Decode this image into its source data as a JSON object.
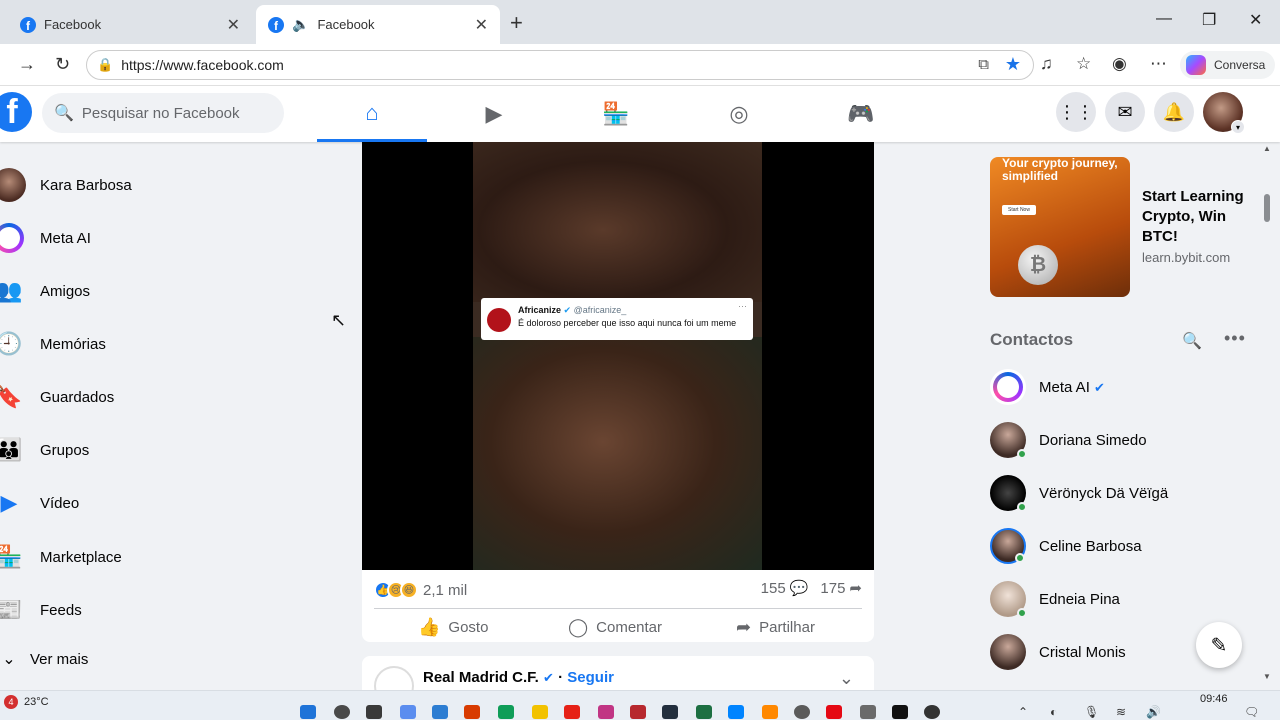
{
  "browser": {
    "tabs": [
      {
        "title": "Facebook",
        "active": false
      },
      {
        "title": "Facebook",
        "active": true
      }
    ],
    "url": "https://www.facebook.com",
    "conversa_label": "Conversa"
  },
  "header": {
    "logo": "f",
    "search_placeholder": "Pesquisar no Facebook",
    "nav_icons": [
      "home-icon",
      "video-icon",
      "marketplace-icon",
      "groups-icon",
      "gaming-icon"
    ]
  },
  "sidebar": {
    "items": [
      {
        "label": "Kara Barbosa",
        "icon": "profile-avatar"
      },
      {
        "label": "Meta AI",
        "icon": "meta-ai-icon"
      },
      {
        "label": "Amigos",
        "icon": "friends-icon"
      },
      {
        "label": "Memórias",
        "icon": "memories-icon"
      },
      {
        "label": "Guardados",
        "icon": "saved-icon"
      },
      {
        "label": "Grupos",
        "icon": "groups-icon"
      },
      {
        "label": "Vídeo",
        "icon": "video-icon"
      },
      {
        "label": "Marketplace",
        "icon": "marketplace-icon"
      },
      {
        "label": "Feeds",
        "icon": "feeds-icon"
      },
      {
        "label": "Ver mais",
        "icon": "chevron-down-icon"
      }
    ]
  },
  "post": {
    "tweet": {
      "name": "Africanize",
      "handle": "@africanize_",
      "text": "É doloroso perceber que isso aqui nunca foi um meme"
    },
    "reactions_count": "2,1 mil",
    "comments_count": "155",
    "shares_count": "175",
    "actions": {
      "like": "Gosto",
      "comment": "Comentar",
      "share": "Partilhar"
    }
  },
  "next_post": {
    "page_name": "Real Madrid C.F.",
    "separator": "·",
    "follow_label": "Seguir"
  },
  "right": {
    "ad": {
      "image_headline": "Your crypto journey, simplified",
      "image_button": "Start Now",
      "title": "Start Learning Crypto, Win BTC!",
      "url": "learn.bybit.com"
    },
    "contacts_title": "Contactos",
    "contacts": [
      {
        "name": "Meta AI",
        "verified": true,
        "online": false
      },
      {
        "name": "Doriana Simedo",
        "verified": false,
        "online": true
      },
      {
        "name": "Vërönyck Dä Vëïgä",
        "verified": false,
        "online": true
      },
      {
        "name": "Celine Barbosa",
        "verified": false,
        "online": true
      },
      {
        "name": "Edneia Pina",
        "verified": false,
        "online": true
      },
      {
        "name": "Cristal Monis",
        "verified": false,
        "online": false
      }
    ]
  },
  "taskbar": {
    "weather_badge": "4",
    "temperature": "23°C",
    "time": "09:46"
  },
  "colors": {
    "facebook_blue": "#1877f2",
    "online_green": "#31a24c",
    "background": "#f0f2f5"
  }
}
